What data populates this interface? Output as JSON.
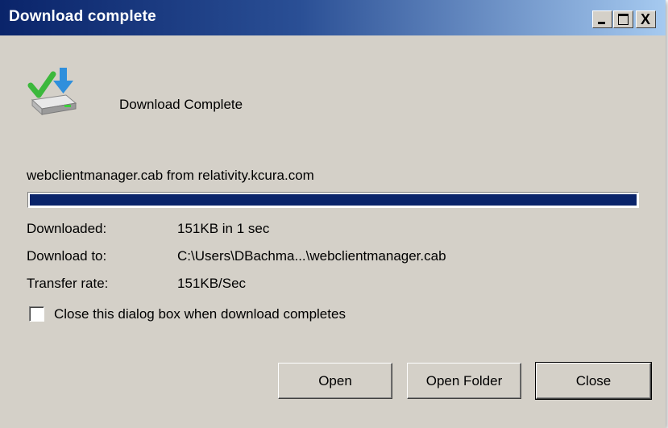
{
  "window": {
    "title": "Download complete"
  },
  "titlebar_buttons": {
    "minimize_icon": "minimize-icon",
    "maximize_icon": "maximize-icon",
    "close_icon": "close-icon",
    "close_glyph": "X"
  },
  "heading": "Download Complete",
  "file": {
    "description": "webclientmanager.cab from relativity.kcura.com"
  },
  "progress": {
    "fraction": 1.0,
    "fill_color": "#0a246a"
  },
  "info": {
    "downloaded_label": "Downloaded:",
    "downloaded_value": "151KB in 1 sec",
    "download_to_label": "Download to:",
    "download_to_value": "C:\\Users\\DBachma...\\webclientmanager.cab",
    "transfer_rate_label": "Transfer rate:",
    "transfer_rate_value": "151KB/Sec"
  },
  "options": {
    "close_when_complete_label": "Close this dialog box when download completes",
    "close_when_complete_checked": false
  },
  "buttons": {
    "open_label": "Open",
    "open_folder_label": "Open Folder",
    "close_label": "Close"
  },
  "icon": "download-complete-icon"
}
